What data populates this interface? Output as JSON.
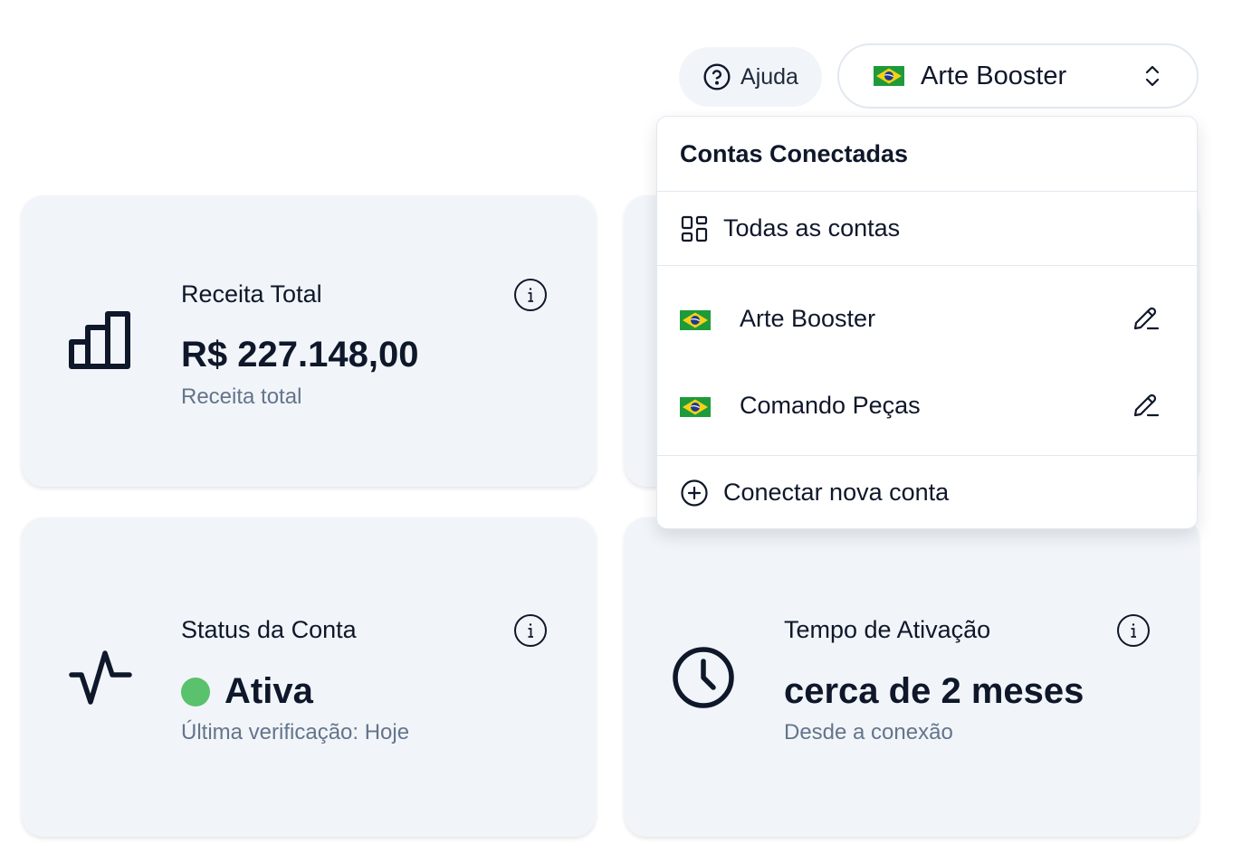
{
  "header": {
    "help_label": "Ajuda",
    "selected_account": "Arte Booster"
  },
  "cards": [
    {
      "title": "Receita Total",
      "value": "R$ 227.148,00",
      "subtitle": "Receita total",
      "icon": "bar-chart-icon"
    },
    {
      "title": "Status da Conta",
      "value": "Ativa",
      "subtitle": "Última verificação: Hoje",
      "icon": "activity-icon",
      "status_color": "#5ac16c"
    },
    {
      "title": "Tempo de Ativação",
      "value": "cerca de 2 meses",
      "subtitle": "Desde a conexão",
      "icon": "clock-icon"
    }
  ],
  "dropdown": {
    "title": "Contas Conectadas",
    "all_accounts_label": "Todas as contas",
    "accounts": [
      {
        "name": "Arte Booster",
        "country_flag": "brazil-flag-icon"
      },
      {
        "name": "Comando Peças",
        "country_flag": "brazil-flag-icon"
      }
    ],
    "connect_label": "Conectar nova conta"
  },
  "colors": {
    "card_background": "#f1f5f9",
    "text_primary": "#0f172a",
    "text_muted": "#64748b",
    "status_active": "#5ac16c"
  }
}
